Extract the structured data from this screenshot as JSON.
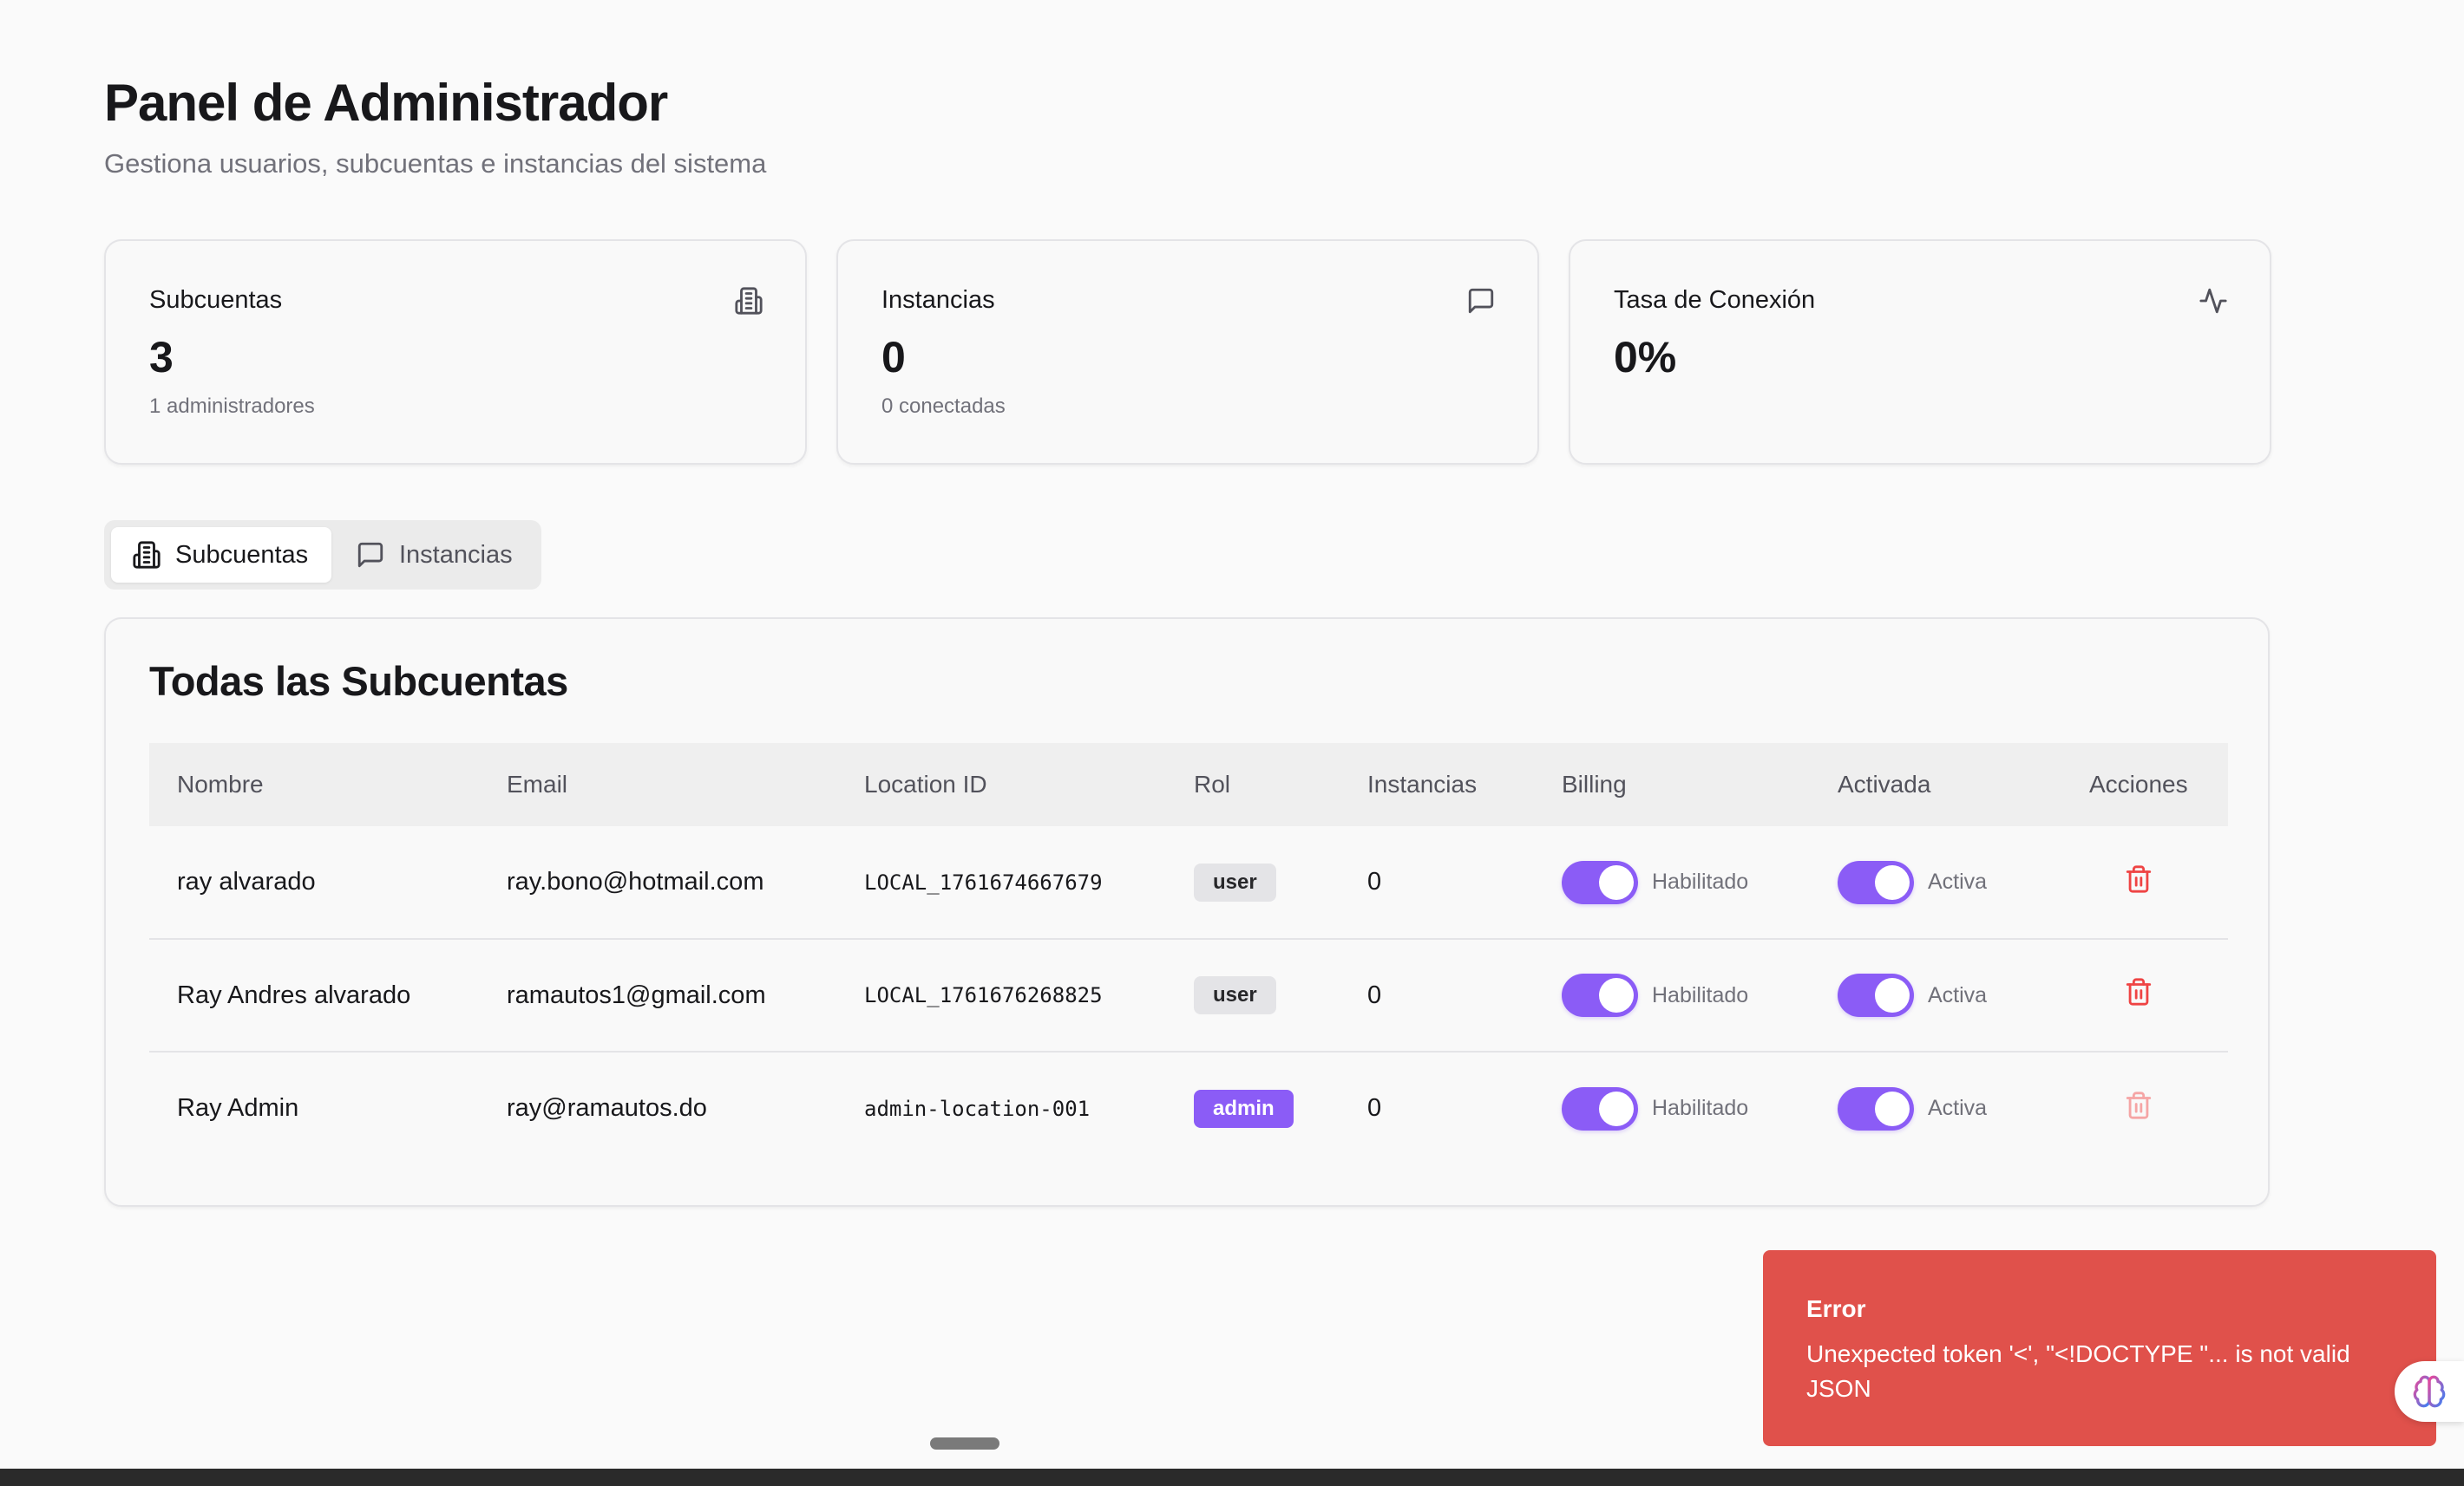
{
  "header": {
    "title": "Panel de Administrador",
    "subtitle": "Gestiona usuarios, subcuentas e instancias del sistema"
  },
  "stats": [
    {
      "label": "Subcuentas",
      "value": "3",
      "description": "1 administradores",
      "icon": "building-icon"
    },
    {
      "label": "Instancias",
      "value": "0",
      "description": "0 conectadas",
      "icon": "message-square-icon"
    },
    {
      "label": "Tasa de Conexión",
      "value": "0%",
      "description": "",
      "icon": "activity-icon"
    }
  ],
  "tabs": [
    {
      "label": "Subcuentas",
      "icon": "building-icon",
      "active": true
    },
    {
      "label": "Instancias",
      "icon": "message-square-icon",
      "active": false
    }
  ],
  "table": {
    "title": "Todas las Subcuentas",
    "columns": [
      "Nombre",
      "Email",
      "Location ID",
      "Rol",
      "Instancias",
      "Billing",
      "Activada",
      "Acciones"
    ],
    "rows": [
      {
        "name": "ray alvarado",
        "email": "ray.bono@hotmail.com",
        "location_id": "LOCAL_1761674667679",
        "role": "user",
        "instances": "0",
        "billing": "Habilitado",
        "billing_on": true,
        "activated": "Activa",
        "activated_on": true,
        "delete_enabled": true
      },
      {
        "name": "Ray Andres alvarado",
        "email": "ramautos1@gmail.com",
        "location_id": "LOCAL_1761676268825",
        "role": "user",
        "instances": "0",
        "billing": "Habilitado",
        "billing_on": true,
        "activated": "Activa",
        "activated_on": true,
        "delete_enabled": true
      },
      {
        "name": "Ray Admin",
        "email": "ray@ramautos.do",
        "location_id": "admin-location-001",
        "role": "admin",
        "instances": "0",
        "billing": "Habilitado",
        "billing_on": true,
        "activated": "Activa",
        "activated_on": true,
        "delete_enabled": false
      }
    ]
  },
  "toast": {
    "title": "Error",
    "message": "Unexpected token '<', \"<!DOCTYPE \"... is not valid JSON",
    "color": "#e0514b"
  },
  "colors": {
    "accent": "#8b5cf6",
    "danger": "#ef4444"
  }
}
